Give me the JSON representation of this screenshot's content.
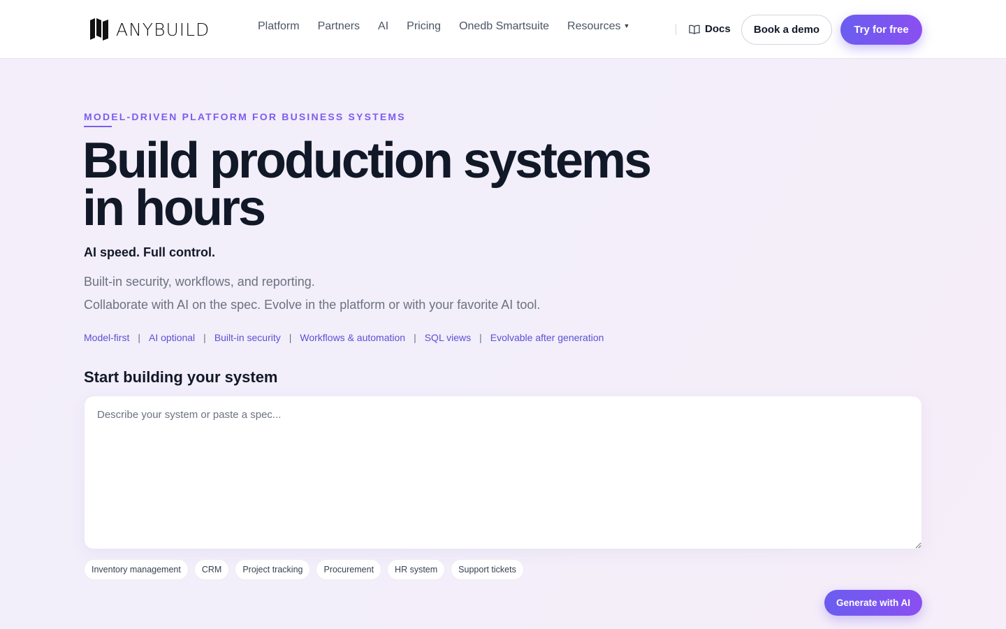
{
  "brand": {
    "name": "ANYBUILD",
    "logo_icon": "anybuild-logo-icon"
  },
  "nav": {
    "items": [
      "Platform",
      "Partners",
      "AI",
      "Pricing",
      "Onedb Smartsuite"
    ],
    "resources": "Resources",
    "docs": "Docs",
    "docs_icon": "book-icon",
    "book_demo": "Book a demo",
    "try_free": "Try for free"
  },
  "hero": {
    "eyebrow": "MODEL-DRIVEN PLATFORM FOR BUSINESS SYSTEMS",
    "headline_line1": "Build production systems",
    "headline_line2": "in hours",
    "subhead": "AI speed. Full control.",
    "desc1": "Built-in security, workflows, and reporting.",
    "desc2": "Collaborate with AI on the spec. Evolve in the platform or with your favorite AI tool.",
    "tags": [
      "Model-first",
      "AI optional",
      "Built-in security",
      "Workflows & automation",
      "SQL views",
      "Evolvable after generation"
    ]
  },
  "builder": {
    "title": "Start building your system",
    "input_value": "",
    "placeholder": "Describe your system or paste a spec...",
    "chips": [
      "Inventory management",
      "CRM",
      "Project tracking",
      "Procurement",
      "HR system",
      "Support tickets"
    ],
    "generate": "Generate with AI"
  },
  "colors": {
    "accent": "#7c5cf0",
    "button_gradient_start": "#6a5df0",
    "button_gradient_end": "#8a4ff0",
    "tag_link": "#5b50d6",
    "background": "#f3eefa"
  }
}
